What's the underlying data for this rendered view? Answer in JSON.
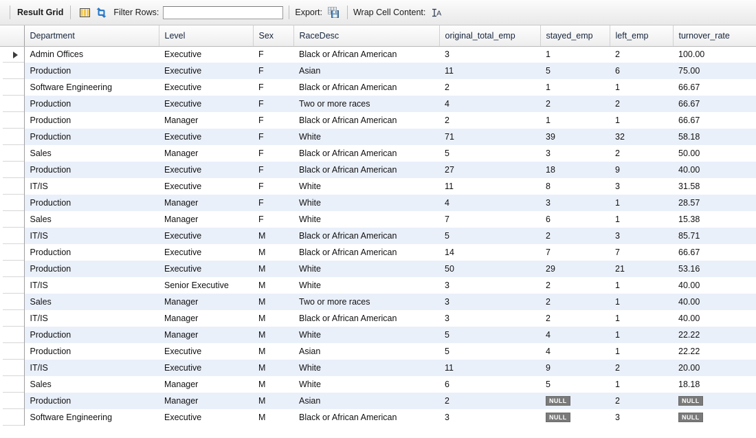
{
  "toolbar": {
    "result_grid_label": "Result Grid",
    "grid_icon": "grid-view-icon",
    "refresh_icon": "refresh-icon",
    "filter_rows_label": "Filter Rows:",
    "filter_value": "",
    "filter_placeholder": "",
    "export_label": "Export:",
    "export_icon": "export-recordset-icon",
    "wrap_cell_label": "Wrap Cell Content:",
    "wrap_icon": "wrap-cell-content-icon"
  },
  "grid": {
    "columns": [
      "Department",
      "Level",
      "Sex",
      "RaceDesc",
      "original_total_emp",
      "stayed_emp",
      "left_emp",
      "turnover_rate"
    ],
    "selected_row_index": 0,
    "rows": [
      {
        "department": "Admin Offices",
        "level": "Executive",
        "sex": "F",
        "race": "Black or African American",
        "original_total_emp": "3",
        "stayed_emp": "1",
        "left_emp": "2",
        "turnover_rate": "100.00"
      },
      {
        "department": "Production",
        "level": "Executive",
        "sex": "F",
        "race": "Asian",
        "original_total_emp": "11",
        "stayed_emp": "5",
        "left_emp": "6",
        "turnover_rate": "75.00"
      },
      {
        "department": "Software Engineering",
        "level": "Executive",
        "sex": "F",
        "race": "Black or African American",
        "original_total_emp": "2",
        "stayed_emp": "1",
        "left_emp": "1",
        "turnover_rate": "66.67"
      },
      {
        "department": "Production",
        "level": "Executive",
        "sex": "F",
        "race": "Two or more races",
        "original_total_emp": "4",
        "stayed_emp": "2",
        "left_emp": "2",
        "turnover_rate": "66.67"
      },
      {
        "department": "Production",
        "level": "Manager",
        "sex": "F",
        "race": "Black or African American",
        "original_total_emp": "2",
        "stayed_emp": "1",
        "left_emp": "1",
        "turnover_rate": "66.67"
      },
      {
        "department": "Production",
        "level": "Executive",
        "sex": "F",
        "race": "White",
        "original_total_emp": "71",
        "stayed_emp": "39",
        "left_emp": "32",
        "turnover_rate": "58.18"
      },
      {
        "department": "Sales",
        "level": "Manager",
        "sex": "F",
        "race": "Black or African American",
        "original_total_emp": "5",
        "stayed_emp": "3",
        "left_emp": "2",
        "turnover_rate": "50.00"
      },
      {
        "department": "Production",
        "level": "Executive",
        "sex": "F",
        "race": "Black or African American",
        "original_total_emp": "27",
        "stayed_emp": "18",
        "left_emp": "9",
        "turnover_rate": "40.00"
      },
      {
        "department": "IT/IS",
        "level": "Executive",
        "sex": "F",
        "race": "White",
        "original_total_emp": "11",
        "stayed_emp": "8",
        "left_emp": "3",
        "turnover_rate": "31.58"
      },
      {
        "department": "Production",
        "level": "Manager",
        "sex": "F",
        "race": "White",
        "original_total_emp": "4",
        "stayed_emp": "3",
        "left_emp": "1",
        "turnover_rate": "28.57"
      },
      {
        "department": "Sales",
        "level": "Manager",
        "sex": "F",
        "race": "White",
        "original_total_emp": "7",
        "stayed_emp": "6",
        "left_emp": "1",
        "turnover_rate": "15.38"
      },
      {
        "department": "IT/IS",
        "level": "Executive",
        "sex": "M",
        "race": "Black or African American",
        "original_total_emp": "5",
        "stayed_emp": "2",
        "left_emp": "3",
        "turnover_rate": "85.71"
      },
      {
        "department": "Production",
        "level": "Executive",
        "sex": "M",
        "race": "Black or African American",
        "original_total_emp": "14",
        "stayed_emp": "7",
        "left_emp": "7",
        "turnover_rate": "66.67"
      },
      {
        "department": "Production",
        "level": "Executive",
        "sex": "M",
        "race": "White",
        "original_total_emp": "50",
        "stayed_emp": "29",
        "left_emp": "21",
        "turnover_rate": "53.16"
      },
      {
        "department": "IT/IS",
        "level": "Senior Executive",
        "sex": "M",
        "race": "White",
        "original_total_emp": "3",
        "stayed_emp": "2",
        "left_emp": "1",
        "turnover_rate": "40.00"
      },
      {
        "department": "Sales",
        "level": "Manager",
        "sex": "M",
        "race": "Two or more races",
        "original_total_emp": "3",
        "stayed_emp": "2",
        "left_emp": "1",
        "turnover_rate": "40.00"
      },
      {
        "department": "IT/IS",
        "level": "Manager",
        "sex": "M",
        "race": "Black or African American",
        "original_total_emp": "3",
        "stayed_emp": "2",
        "left_emp": "1",
        "turnover_rate": "40.00"
      },
      {
        "department": "Production",
        "level": "Manager",
        "sex": "M",
        "race": "White",
        "original_total_emp": "5",
        "stayed_emp": "4",
        "left_emp": "1",
        "turnover_rate": "22.22"
      },
      {
        "department": "Production",
        "level": "Executive",
        "sex": "M",
        "race": "Asian",
        "original_total_emp": "5",
        "stayed_emp": "4",
        "left_emp": "1",
        "turnover_rate": "22.22"
      },
      {
        "department": "IT/IS",
        "level": "Executive",
        "sex": "M",
        "race": "White",
        "original_total_emp": "11",
        "stayed_emp": "9",
        "left_emp": "2",
        "turnover_rate": "20.00"
      },
      {
        "department": "Sales",
        "level": "Manager",
        "sex": "M",
        "race": "White",
        "original_total_emp": "6",
        "stayed_emp": "5",
        "left_emp": "1",
        "turnover_rate": "18.18"
      },
      {
        "department": "Production",
        "level": "Manager",
        "sex": "M",
        "race": "Asian",
        "original_total_emp": "2",
        "stayed_emp": "NULL",
        "left_emp": "2",
        "turnover_rate": "NULL"
      },
      {
        "department": "Software Engineering",
        "level": "Executive",
        "sex": "M",
        "race": "Black or African American",
        "original_total_emp": "3",
        "stayed_emp": "NULL",
        "left_emp": "3",
        "turnover_rate": "NULL"
      }
    ]
  }
}
